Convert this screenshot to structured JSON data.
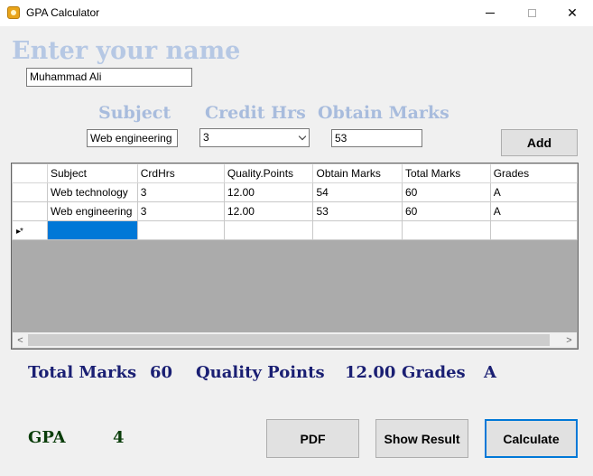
{
  "window": {
    "title": "GPA Calculator",
    "icon": "app-icon",
    "controls": [
      "minimize-icon",
      "maximize-icon",
      "close-icon"
    ],
    "close_glyph": "✕"
  },
  "form": {
    "name_heading": "Enter your name",
    "name_value": "Muhammad Ali",
    "subject_label": "Subject",
    "subject_value": "Web engineering",
    "credit_label": "Credit Hrs",
    "credit_value": "3",
    "marks_label": "Obtain Marks",
    "marks_value": "53",
    "add_button": "Add"
  },
  "grid": {
    "columns": [
      "Subject",
      "CrdHrs",
      "Quality.Points",
      "Obtain Marks",
      "Total Marks",
      "Grades"
    ],
    "rows": [
      [
        "Web technology",
        "3",
        "12.00",
        "54",
        "60",
        "A"
      ],
      [
        "Web engineering",
        "3",
        "12.00",
        "53",
        "60",
        "A"
      ]
    ],
    "new_row_marker": "▸*",
    "scroll_left": "<",
    "scroll_right": ">"
  },
  "summary": {
    "total_marks_label": "Total Marks",
    "total_marks_value": "60",
    "quality_points_label": "Quality Points",
    "quality_points_value": "12.00",
    "grades_label": "Grades",
    "grades_value": "A",
    "gpa_label": "GPA",
    "gpa_value": "4"
  },
  "buttons": {
    "pdf": "PDF",
    "show_result": "Show Result",
    "calculate": "Calculate"
  },
  "colors": {
    "heading": "#b6c8e4",
    "summary": "#1a1f73",
    "gpa": "#0a3d0a",
    "selection": "#0078d7"
  }
}
